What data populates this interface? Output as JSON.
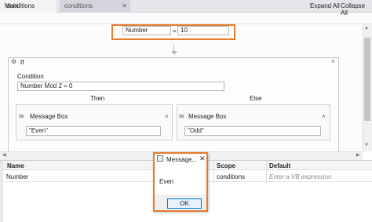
{
  "tabs": [
    {
      "label": "Main (ReadOnly)"
    },
    {
      "label": "conditions (ReadOnly)",
      "close": "✕"
    }
  ],
  "breadcrumb": "conditions",
  "toolbar": {
    "expand_all": "Expand All",
    "collapse_all": "Collapse All"
  },
  "assign": {
    "to": "Number",
    "operator": "=",
    "value": "10"
  },
  "if_activity": {
    "title": "If",
    "condition_label": "Condition",
    "condition": "Number Mod 2 = 0",
    "then_label": "Then",
    "else_label": "Else"
  },
  "then_message": {
    "title": "Message Box",
    "text": "\"Even\""
  },
  "else_message": {
    "title": "Message Box",
    "text": "\"Odd\""
  },
  "variables": {
    "headers": {
      "name": "Name",
      "scope": "Scope",
      "default": "Default"
    },
    "rows": [
      {
        "name": "Number",
        "scope": "conditions",
        "default": "Enter a VB expression"
      }
    ]
  },
  "dialog": {
    "title": "Message...",
    "close": "✕",
    "message": "Even",
    "ok": "OK"
  },
  "colors": {
    "highlight": "#e87a2c",
    "ok_border": "#0078d7"
  },
  "icons": [
    "if-icon",
    "message-box-icon",
    "collapse-chevron-icon",
    "close-icon",
    "window-icon"
  ]
}
